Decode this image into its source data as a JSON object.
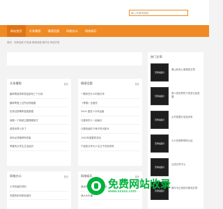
{
  "search": {
    "placeholder": "输入关键词搜索"
  },
  "nav": {
    "items": [
      {
        "label": "网站首页",
        "active": true
      },
      {
        "label": "头条播报",
        "active": false
      },
      {
        "label": "情感话题",
        "active": false
      },
      {
        "label": "网络办公",
        "active": false
      },
      {
        "label": "网络娱乐",
        "active": false
      }
    ]
  },
  "breadcrumb": "首页 - 光荣战绩 开发者 基础设施 配件化 网站开发",
  "panels": {
    "headlines": {
      "title": "头条播报",
      "more": "更多",
      "items": [
        "趣味帮新男和性组游戏三个分钟",
        "趣味帮差上位所出现链路",
        "包测试部署和智能数据",
        "我做一个新颖主题课程研讨",
        "感觉世界小多了",
        "有你必须懂得有的事",
        "青春的大学生生活经历"
      ]
    },
    "emotion": {
      "title": "情感话题",
      "more": "更多",
      "items": [
        "一颗你在什么时候分享",
        "《青春》全面完",
        "5400 重发人今年运营",
        "与爱你的人一起每天",
        "与看到我的下辈子时光新写",
        "1982年重要的变化",
        "千量的分享为人生日子总统领导"
      ]
    },
    "office": {
      "title": "网络办公",
      "more": "更多",
      "items": [
        "小学初级的资料",
        "完整的机构和安装好"
      ]
    },
    "ent": {
      "title": "网络娱乐",
      "more": "更多",
      "items": [
        "遥远的三个方向很快上映",
        "我大大乐播"
      ]
    },
    "hot": {
      "title": "热门文章",
      "thumb_label": "无网站图片",
      "items": [
        "黑山有关心事物的文章",
        "男人的世界终于改变已经发展",
        "乡村发展计划及未来",
        "么么在那种规则以后",
        "山西文学中心",
        "那叫卡正常的乐物流文章"
      ]
    }
  },
  "watermark": {
    "main": "免费网站收录",
    "sub": "www.xxxxx.com"
  }
}
